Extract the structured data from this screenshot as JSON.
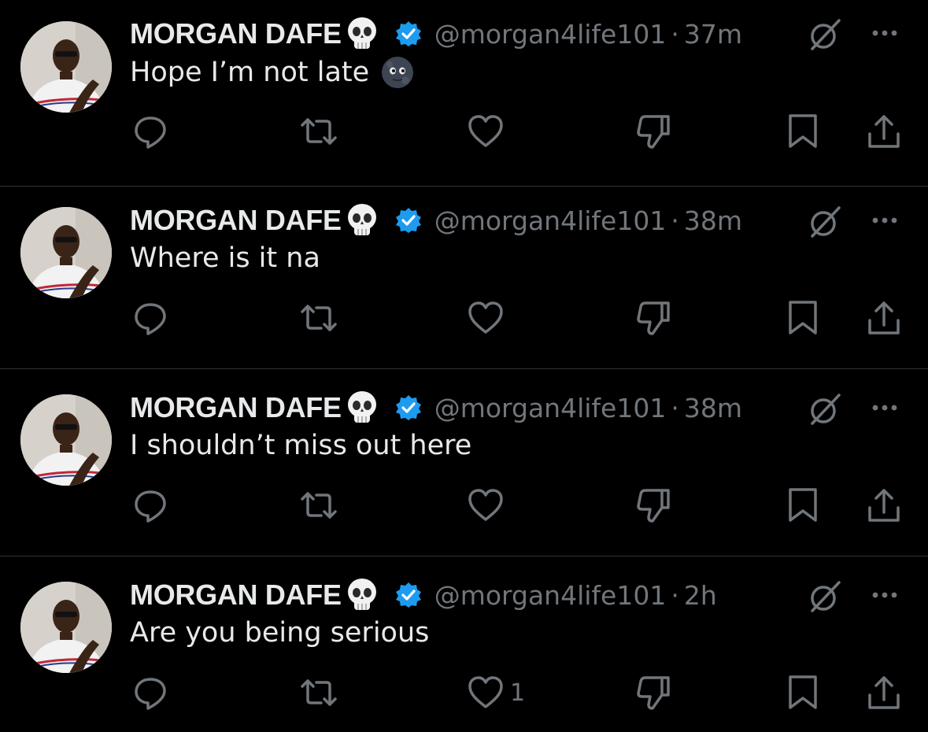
{
  "colors": {
    "background": "#000000",
    "primary_text": "#e7e9ea",
    "secondary_text": "#71767b",
    "divider": "#2f3336",
    "verified": "#1d9bf0"
  },
  "icons": {
    "reply": "reply-icon",
    "repost": "repost-icon",
    "like": "heart-icon",
    "dislike": "thumbs-down-icon",
    "bookmark": "bookmark-icon",
    "share": "share-icon",
    "more": "more-icon",
    "grok": "grok-icon",
    "verified": "verified-badge-icon",
    "name_emoji": "skull-emoji",
    "text_emoji": "new-moon-face-emoji"
  },
  "tweets": [
    {
      "author_name": "MORGAN DAFE",
      "handle": "@morgan4life101",
      "separator": "·",
      "time": "37m",
      "text": "Hope I’m not late",
      "like_count": ""
    },
    {
      "author_name": "MORGAN DAFE",
      "handle": "@morgan4life101",
      "separator": "·",
      "time": "38m",
      "text": "Where is it na",
      "like_count": ""
    },
    {
      "author_name": "MORGAN DAFE",
      "handle": "@morgan4life101",
      "separator": "·",
      "time": "38m",
      "text": "I shouldn’t miss out here",
      "like_count": ""
    },
    {
      "author_name": "MORGAN DAFE",
      "handle": "@morgan4life101",
      "separator": "·",
      "time": "2h",
      "text": "Are you being serious",
      "like_count": "1"
    }
  ]
}
